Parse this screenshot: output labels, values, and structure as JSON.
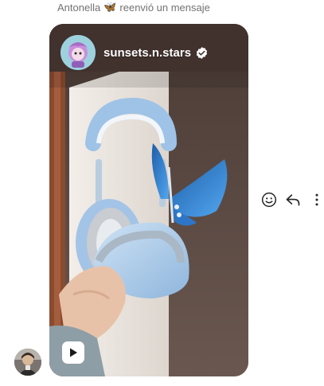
{
  "forward": {
    "sender": "Antonella",
    "emoji": "🦋",
    "text": "reenvió un mensaje"
  },
  "post": {
    "username": "sunsets.n.stars",
    "verified": true,
    "type_icon": "play-icon"
  },
  "icons": {
    "react": "smiley-icon",
    "reply": "reply-arrow-icon",
    "more": "more-vertical-icon"
  },
  "colors": {
    "secondary_text": "#737373",
    "icon": "#262626",
    "verified_badge": "#ffffff"
  }
}
